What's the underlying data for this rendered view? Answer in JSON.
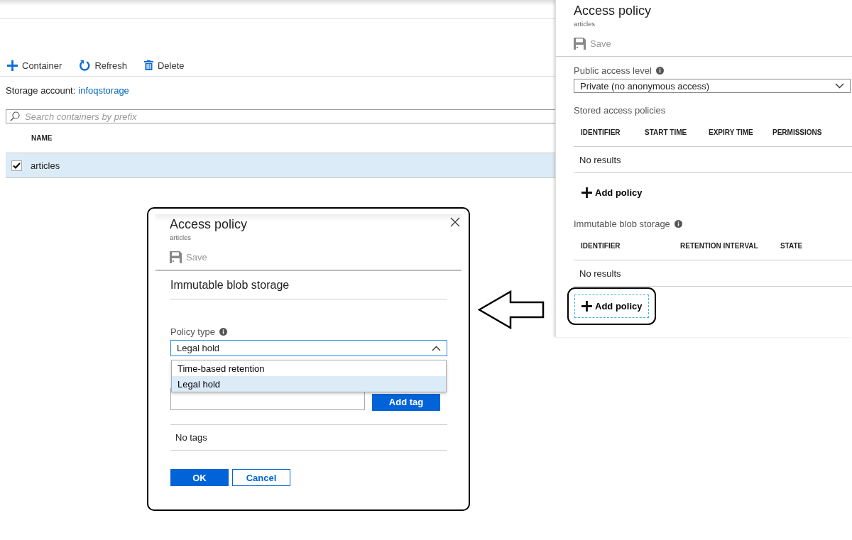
{
  "toolbar": [
    {
      "kind": "add",
      "label": "Container"
    },
    {
      "kind": "refresh",
      "label": "Refresh"
    },
    {
      "kind": "delete",
      "label": "Delete"
    }
  ],
  "storage_account": {
    "label": "Storage account:",
    "value": "infoqstorage"
  },
  "search": {
    "placeholder": "Search containers by prefix"
  },
  "containers": {
    "columns": [
      "NAME"
    ],
    "rows": [
      {
        "name": "articles",
        "checked": true,
        "selected": true
      }
    ]
  },
  "blade": {
    "title": "Access policy",
    "subtitle": "articles",
    "save": {
      "label": "Save",
      "disabled": true
    },
    "public_access": {
      "label": "Public access level",
      "value": "Private (no anonymous access)"
    },
    "sections": [
      {
        "kind": "stored",
        "label": "Stored access policies",
        "columns": [
          "IDENTIFIER",
          "START TIME",
          "EXPIRY TIME",
          "PERMISSIONS"
        ],
        "empty": "No results",
        "add_label": "Add policy",
        "highlighted": false
      },
      {
        "kind": "immutable",
        "label": "Immutable blob storage",
        "columns": [
          "IDENTIFIER",
          "RETENTION INTERVAL",
          "STATE"
        ],
        "empty": "No results",
        "add_label": "Add policy",
        "highlighted": true
      }
    ]
  },
  "dialog": {
    "title": "Access policy",
    "subtitle": "articles",
    "save": {
      "label": "Save",
      "disabled": true
    },
    "section_title": "Immutable blob storage",
    "policy_type": {
      "label": "Policy type",
      "value": "Legal hold",
      "expanded": true,
      "options": [
        {
          "label": "Time-based retention",
          "selected": false
        },
        {
          "label": "Legal hold",
          "selected": true
        }
      ]
    },
    "tag_button": "Add tag",
    "empty": "No tags",
    "buttons": [
      {
        "label": "OK",
        "kind": "primary"
      },
      {
        "label": "Cancel",
        "kind": "secondary"
      }
    ]
  }
}
